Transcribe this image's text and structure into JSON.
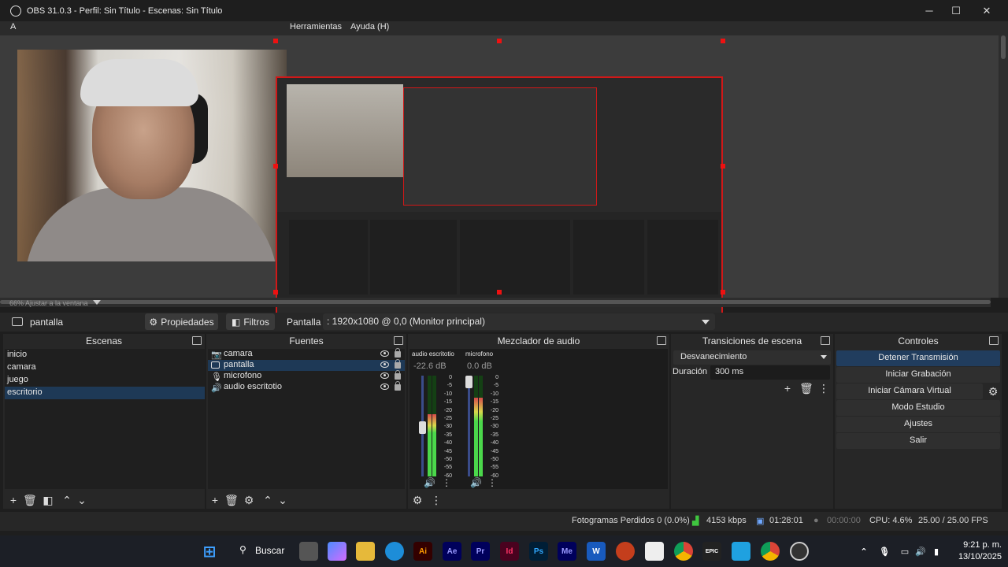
{
  "window": {
    "title": "OBS 31.0.3 - Perfil: Sin Título - Escenas: Sin Título",
    "minimize": "─",
    "maximize": "☐",
    "close": "✕"
  },
  "menu": {
    "items": [
      "Herramientas",
      "Ayuda (H)"
    ],
    "partial": "A"
  },
  "preview": {
    "zoom_label": "66%  Ajustar a la ventana"
  },
  "source_toolbar": {
    "source_name": "pantalla",
    "properties_label": "Propiedades",
    "filters_label": "Filtros",
    "display_label": "Pantalla",
    "monitor_value": ": 1920x1080 @ 0,0 (Monitor principal)"
  },
  "docks": {
    "scenes": {
      "title": "Escenas",
      "items": [
        "inicio",
        "camara",
        "juego",
        "escritorio"
      ],
      "selected_index": 3
    },
    "sources": {
      "title": "Fuentes",
      "items": [
        {
          "label": "camara",
          "icon": "camera-icon"
        },
        {
          "label": "pantalla",
          "icon": "monitor-icon"
        },
        {
          "label": "microfono",
          "icon": "microphone-icon"
        },
        {
          "label": "audio escritotio",
          "icon": "speaker-icon"
        }
      ],
      "selected_index": 1
    },
    "mixer": {
      "title": "Mezclador de audio",
      "channels": [
        {
          "name": "audio escritotio",
          "db": "-22.6 dB",
          "level": 0.62,
          "fader": 0.48
        },
        {
          "name": "microfono",
          "db": "0.0 dB",
          "level": 0.78,
          "fader": 1.0
        }
      ],
      "scale": [
        "0",
        "-5",
        "-10",
        "-15",
        "-20",
        "-25",
        "-30",
        "-35",
        "-40",
        "-45",
        "-50",
        "-55",
        "-60"
      ]
    },
    "transitions": {
      "title": "Transiciones de escena",
      "selected": "Desvanecimiento",
      "duration_label": "Duración",
      "duration_value": "300 ms"
    },
    "controls": {
      "title": "Controles",
      "buttons": [
        "Detener Transmisión",
        "Iniciar Grabación",
        "Iniciar Cámara Virtual",
        "Modo Estudio",
        "Ajustes",
        "Salir"
      ]
    }
  },
  "status": {
    "dropped": "Fotogramas Perdidos 0 (0.0%)",
    "bitrate": "4153 kbps",
    "stream_time": "01:28:01",
    "rec_time": "00:00:00",
    "cpu": "CPU: 4.6%",
    "fps": "25.00 / 25.00 FPS"
  },
  "taskbar": {
    "search": "Buscar",
    "apps": [
      "Ai",
      "Ae",
      "Pr",
      "Id",
      "Ps",
      "Me",
      "W"
    ],
    "time": "9:21 p. m.",
    "date": "13/10/2025"
  },
  "colors": {
    "selection": "#1e3956",
    "meter_green": "#4bd84b",
    "meter_yellow": "#d8d84b",
    "meter_red": "#d84b4b",
    "bounding_box": "#d01818"
  }
}
